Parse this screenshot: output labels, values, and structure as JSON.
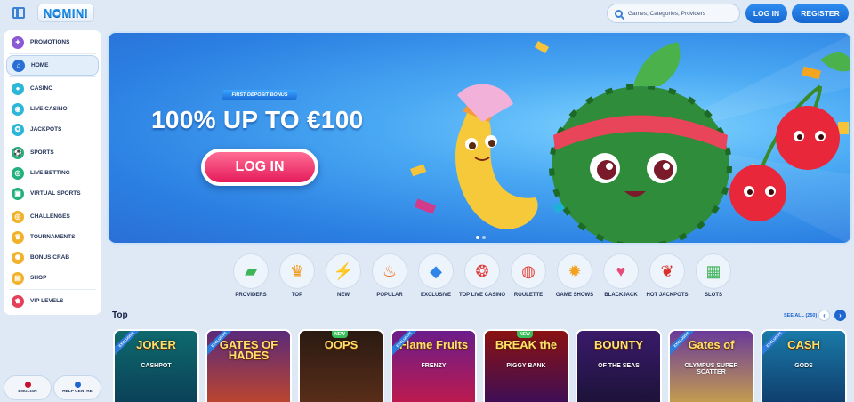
{
  "header": {
    "logo_text": "NOMINI",
    "search_placeholder": "Games, Categories, Providers",
    "login_label": "LOG IN",
    "register_label": "REGISTER"
  },
  "sidebar": {
    "items": [
      {
        "label": "PROMOTIONS",
        "icon": "gift-icon",
        "color": "#8a5ad6"
      },
      {
        "label": "HOME",
        "icon": "home-icon",
        "color": "#2a6fd6"
      },
      {
        "label": "CASINO",
        "icon": "casino-chip-icon",
        "color": "#2cb6d8"
      },
      {
        "label": "LIVE CASINO",
        "icon": "live-dealer-icon",
        "color": "#2cb6d8"
      },
      {
        "label": "JACKPOTS",
        "icon": "jackpot-icon",
        "color": "#2cb6d8"
      },
      {
        "label": "SPORTS",
        "icon": "football-icon",
        "color": "#22b07d"
      },
      {
        "label": "LIVE BETTING",
        "icon": "live-betting-icon",
        "color": "#22b07d"
      },
      {
        "label": "VIRTUAL SPORTS",
        "icon": "virtual-sports-icon",
        "color": "#22b07d"
      },
      {
        "label": "CHALLENGES",
        "icon": "target-icon",
        "color": "#f2b12a"
      },
      {
        "label": "TOURNAMENTS",
        "icon": "trophy-icon",
        "color": "#f2b12a"
      },
      {
        "label": "BONUS CRAB",
        "icon": "crab-icon",
        "color": "#f2b12a"
      },
      {
        "label": "SHOP",
        "icon": "shop-icon",
        "color": "#f2b12a"
      },
      {
        "label": "VIP LEVELS",
        "icon": "vip-crown-icon",
        "color": "#e5405a"
      }
    ],
    "language_label": "ENGLISH",
    "help_label": "HELP CENTRE"
  },
  "banner": {
    "tag": "FIRST DEPOSIT BONUS",
    "headline": "100% UP TO €100",
    "cta": "LOG IN"
  },
  "categories": [
    {
      "label": "PROVIDERS",
      "icon": "providers-icon",
      "color": "#3fb55a"
    },
    {
      "label": "TOP",
      "icon": "crown-icon",
      "color": "#f29a1e"
    },
    {
      "label": "NEW",
      "icon": "lightning-icon",
      "color": "#f5a51f"
    },
    {
      "label": "POPULAR",
      "icon": "fire-icon",
      "color": "#f0701e"
    },
    {
      "label": "EXCLUSIVE",
      "icon": "diamond-icon",
      "color": "#2f86e8"
    },
    {
      "label": "TOP LIVE CASINO",
      "icon": "chips-icon",
      "color": "#e23a3a"
    },
    {
      "label": "ROULETTE",
      "icon": "roulette-icon",
      "color": "#e8413a"
    },
    {
      "label": "GAME SHOWS",
      "icon": "game-show-icon",
      "color": "#f3a11e"
    },
    {
      "label": "BLACKJACK",
      "icon": "cards-icon",
      "color": "#e84a7a"
    },
    {
      "label": "HOT JACKPOTS",
      "icon": "chili-icon",
      "color": "#d9302a"
    },
    {
      "label": "SLOTS",
      "icon": "slot-machine-icon",
      "color": "#3bb356"
    }
  ],
  "top_section": {
    "title": "Top",
    "see_all": "SEE ALL (250)"
  },
  "games": [
    {
      "title": "JOKER",
      "sub": "CASHPOT",
      "badge": "EXCLUSIVE",
      "bg": "#0e6a6e",
      "bg2": "#0a3e57"
    },
    {
      "title": "GATES OF HADES",
      "sub": "",
      "badge": "EXCLUSIVE",
      "bg": "#5a2a7a",
      "bg2": "#c2472a"
    },
    {
      "title": "OOPS",
      "sub": "",
      "badge": "NEW",
      "bg": "#2a1a12",
      "bg2": "#5c2f1a"
    },
    {
      "title": "Flame Fruits",
      "sub": "FRENZY",
      "badge": "EXCLUSIVE",
      "bg": "#6a1d8a",
      "bg2": "#c21a4a"
    },
    {
      "title": "BREAK the",
      "sub": "PIGGY BANK",
      "badge": "NEW",
      "bg": "#8a1212",
      "bg2": "#3a0e5a"
    },
    {
      "title": "BOUNTY",
      "sub": "OF THE SEAS",
      "badge": "",
      "bg": "#3a1a6a",
      "bg2": "#1a1236"
    },
    {
      "title": "Gates of",
      "sub": "OLYMPUS SUPER SCATTER",
      "badge": "EXCLUSIVE",
      "bg": "#6a3a9a",
      "bg2": "#c9a34a"
    },
    {
      "title": "CASH",
      "sub": "GODS",
      "badge": "EXCLUSIVE",
      "bg": "#1a7aa8",
      "bg2": "#0e3a6a"
    }
  ]
}
